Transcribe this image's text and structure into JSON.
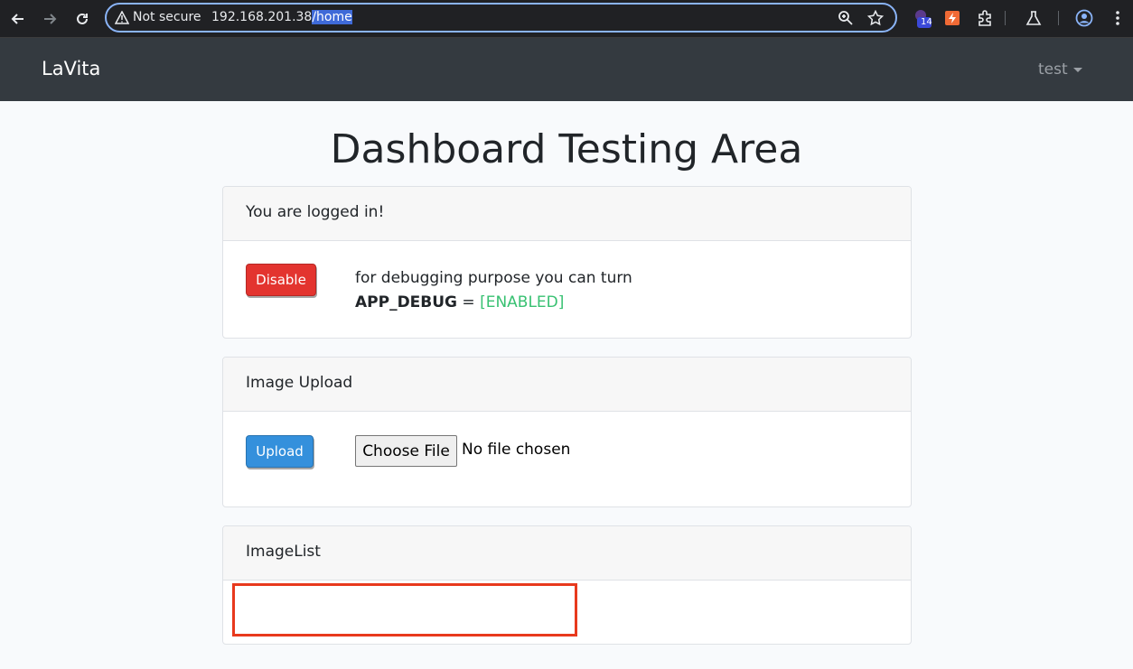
{
  "browser": {
    "security_label": "Not secure",
    "url_host": "192.168.201.38",
    "url_path": "/home",
    "extension_badge": "14"
  },
  "navbar": {
    "brand": "LaVita",
    "user": "test"
  },
  "page": {
    "title": "Dashboard Testing Area"
  },
  "status_card": {
    "header": "You are logged in!",
    "button_label": "Disable",
    "debug_text": "for debugging purpose you can turn",
    "debug_key": "APP_DEBUG",
    "debug_equals": " = ",
    "debug_value": "[ENABLED]",
    "colors": {
      "button": "#e3342f",
      "value": "#38c172"
    }
  },
  "upload_card": {
    "header": "Image Upload",
    "button_label": "Upload",
    "file_button_label": "Choose File",
    "file_status": "No file chosen",
    "colors": {
      "button": "#3490dc"
    }
  },
  "list_card": {
    "header": "ImageList"
  },
  "colors": {
    "navbar_bg": "#343a40",
    "page_bg": "#f8fafc",
    "highlight": "#e8391d"
  }
}
